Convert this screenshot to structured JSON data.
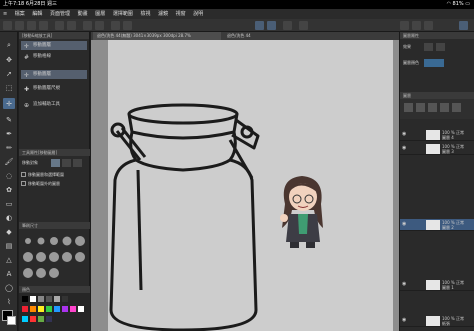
{
  "status": {
    "time": "上午7:18",
    "date": "6月28日 週三",
    "battery": "81%"
  },
  "menu": [
    "檔案",
    "編輯",
    "頁面管理",
    "動畫",
    "圖層",
    "選擇範圍",
    "檢視",
    "濾鏡",
    "視窗",
    "說明"
  ],
  "tool_panel": {
    "title": "[移動&縮放工具]",
    "items": [
      "移動圖層",
      "移動圖層",
      "移動格線",
      "移動圖層尺規"
    ],
    "add_button": "追加輔助工具"
  },
  "tool_property": {
    "title": "工具屬性[移動圖層]",
    "move_target_label": "移動對象",
    "options": [
      "移動圖層和選擇範圍",
      "移動範圍外的圖層"
    ]
  },
  "brush_size": {
    "title": "筆刷尺寸"
  },
  "color_panel": {
    "title": "顏色"
  },
  "canvas_tabs": [
    "退色/洗色 44(無題) 3041×3039px 300dpi 28.7%",
    "退色/洗色 44"
  ],
  "right_panel": {
    "navigator_title": "圖層屬性",
    "effect_label": "效果",
    "layer_color_label": "圖層顏色",
    "layers_title": "圖層"
  },
  "layers": [
    {
      "name": "100 % 正常",
      "sub": "圖層 4"
    },
    {
      "name": "100 % 正常",
      "sub": "圖層 3"
    },
    {
      "name": "100 % 正常",
      "sub": "圖層 2"
    },
    {
      "name": "100 % 正常",
      "sub": "圖層 1"
    },
    {
      "name": "100 % 正常",
      "sub": "紙張"
    }
  ],
  "colors": {
    "accent": "#4a6a8e",
    "jar_stroke": "#1b1b1b",
    "hair": "#4a3630",
    "skin": "#f1d2be",
    "jacket": "#3d3d45",
    "shirt": "#3f9c72"
  }
}
